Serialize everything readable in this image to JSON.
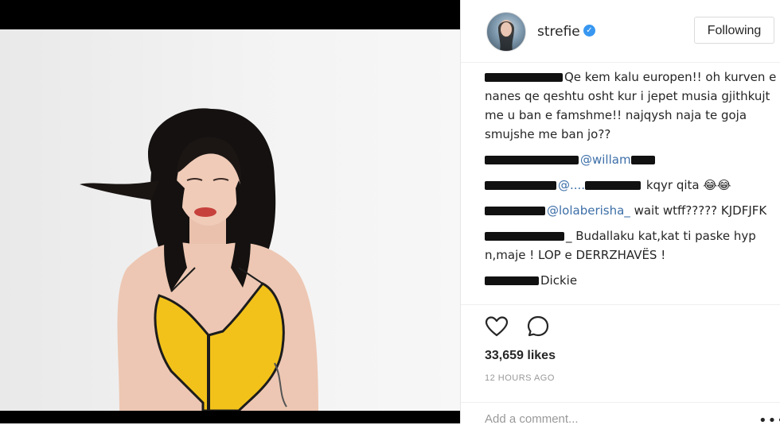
{
  "post": {
    "username": "strefie",
    "follow_label": "Following",
    "verified_mark": "✓",
    "likes": "33,659 likes",
    "time": "12 HOURS AGO",
    "add_comment_placeholder": "Add a comment...",
    "more_label": "•••"
  },
  "comments": [
    {
      "text": "Qe kem kalu europen!! oh kurven e nanes qe qeshtu osht kur i jepet musia gjithkujt me u ban e famshme!! najqysh naja te goja smujshe me ban jo??"
    },
    {
      "mention": "@willam"
    },
    {
      "mention": "@....",
      "text": " kqyr qita 😂😂"
    },
    {
      "mention": "@lolaberisha_",
      "text": " wait wtff????? KJDFJFK"
    },
    {
      "text": "_ Budallaku kat,kat ti paske hyp n,maje ! LOP e DERRZHAVËS !"
    },
    {
      "text": "Dickie"
    }
  ],
  "colors": {
    "verified": "#3897f0",
    "mention": "#3d6fa8",
    "top_yellow": "#f2c21b"
  },
  "icons": {
    "like": "heart-icon",
    "comment": "comment-bubble-icon"
  }
}
